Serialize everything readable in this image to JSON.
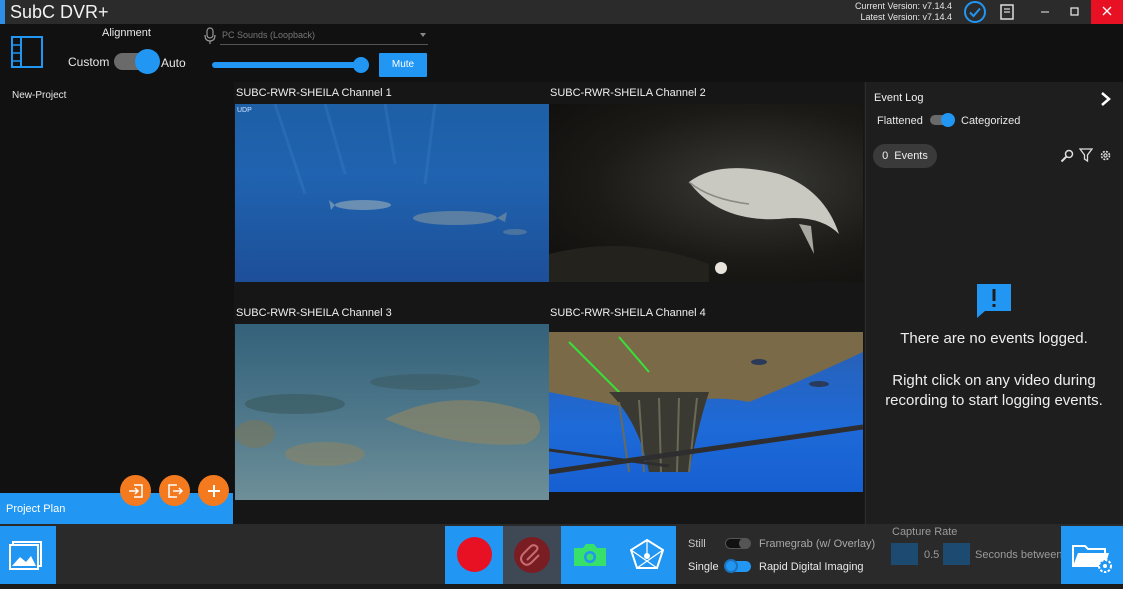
{
  "window": {
    "title": "SubC DVR+",
    "current_version": "Current Version: v7.14.4",
    "latest_version": "Latest Version: v7.14.4"
  },
  "toolbar": {
    "alignment_label": "Alignment",
    "custom_label": "Custom",
    "auto_label": "Auto",
    "audio_source": "PC Sounds (Loopback)",
    "mute_label": "Mute",
    "volume": 1.0
  },
  "project": {
    "name": "New-Project",
    "plan_label": "Project Plan"
  },
  "videos": [
    {
      "label": "SUBC-RWR-SHEILA Channel 1",
      "tag": "UDP"
    },
    {
      "label": "SUBC-RWR-SHEILA Channel 2"
    },
    {
      "label": "SUBC-RWR-SHEILA Channel 3"
    },
    {
      "label": "SUBC-RWR-SHEILA Channel 4"
    }
  ],
  "event_log": {
    "title": "Event Log",
    "flattened_label": "Flattened",
    "categorized_label": "Categorized",
    "count": "0",
    "events_label": "Events",
    "empty_message": "There are no events logged.",
    "hint": "Right click on any video during recording to start logging events."
  },
  "capture": {
    "still_label": "Still",
    "single_label": "Single",
    "framegrab_label": "Framegrab (w/ Overlay)",
    "rdi_label": "Rapid Digital Imaging",
    "rate_title": "Capture Rate",
    "rate_value": "0.5",
    "rate_suffix": "Seconds between s"
  },
  "colors": {
    "accent": "#2196f3",
    "record": "#e81123",
    "fab": "#f47a1f",
    "close": "#e81123"
  }
}
